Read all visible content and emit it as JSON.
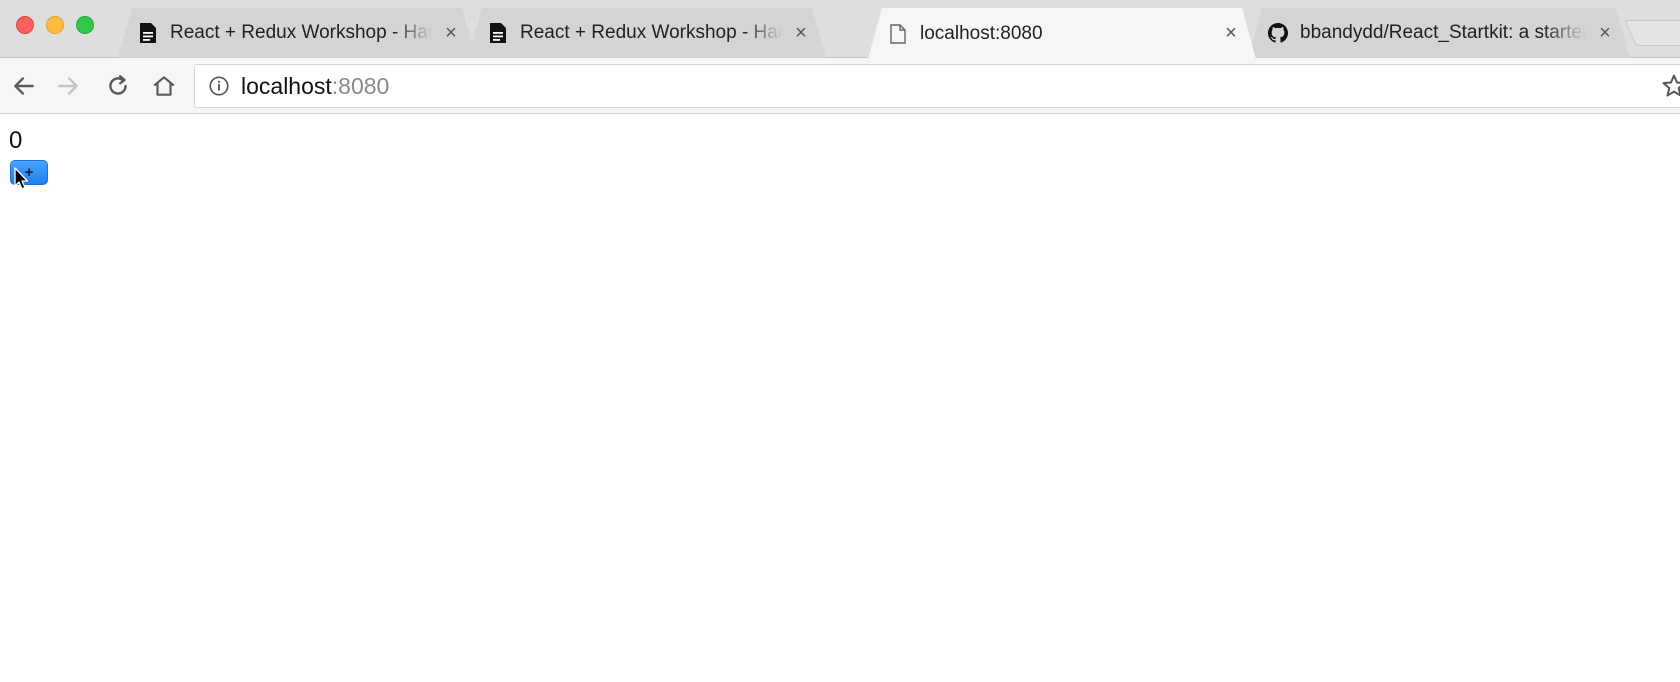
{
  "window": {
    "colors": {
      "close": "#fc605c",
      "minimize": "#fdbc40",
      "maximize": "#34c84a"
    }
  },
  "tabs": [
    {
      "title": "React + Redux Workshop - Hackpad",
      "icon": "document-icon",
      "active": false
    },
    {
      "title": "React + Redux Workshop - Hackpad",
      "icon": "document-icon",
      "active": false
    },
    {
      "title": "localhost:8080",
      "icon": "blank-page-icon",
      "active": true
    },
    {
      "title": "bbandydd/React_Startkit: a starter kit",
      "icon": "github-icon",
      "active": false
    }
  ],
  "toolbar": {
    "url_host": "localhost",
    "url_port": ":8080"
  },
  "page": {
    "counter_value": "0",
    "increment_label": "+",
    "accent": "#2b8cf5"
  }
}
